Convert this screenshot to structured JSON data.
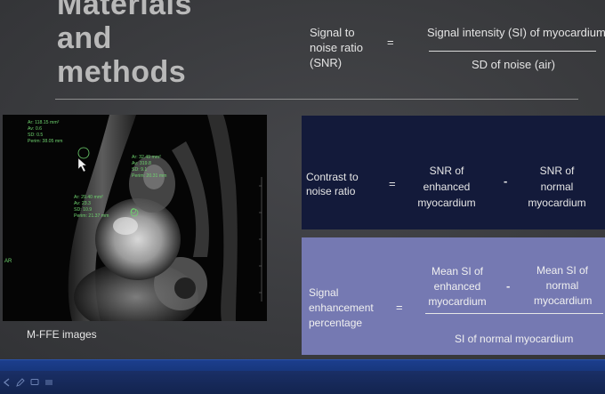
{
  "slide": {
    "title_lines": [
      "Materials",
      "and",
      "methods"
    ],
    "snr": {
      "label_lines": [
        "Signal to",
        "noise ratio",
        "(SNR)"
      ],
      "equals": "=",
      "numerator": "Signal intensity (SI)  of myocardium",
      "denominator": "SD of noise (air)"
    },
    "mri": {
      "caption": "M-FFE images",
      "overlay_texts": [
        "Ar: 118.15 mm²",
        "Av: 0.6",
        "SD: 0.5",
        "Perim: 38.05 mm",
        "Ar: 32.49 mm²",
        "Av: 319.8",
        "SD: 9.1",
        "Perim: 20.31 mm",
        "Ar: 29.40 mm²",
        "Av: 23.3",
        "SD: 10.9",
        "Perim: 21.37 mm",
        "AR"
      ]
    },
    "cnr": {
      "label_lines": [
        "Contrast to",
        "noise ratio"
      ],
      "equals": "=",
      "term_a_lines": [
        "SNR of",
        "enhanced",
        "myocardium"
      ],
      "minus": "-",
      "term_b_lines": [
        "SNR of",
        "normal",
        "myocardium"
      ]
    },
    "sep": {
      "label_lines": [
        "Signal",
        "enhancement",
        "percentage"
      ],
      "equals": "=",
      "term_a_lines": [
        "Mean SI of",
        "enhanced",
        "myocardium"
      ],
      "minus": "-",
      "term_b_lines": [
        "Mean SI of",
        "normal",
        "myocardium"
      ],
      "denominator": "SI of normal myocardium"
    }
  },
  "colors": {
    "background": "#3a3b3e",
    "title": "#b9b9b9",
    "cnr_box": "#131a3a",
    "sep_box": "#7579b2",
    "taskbar": "#163579",
    "overlay_green": "#6fd36f"
  },
  "taskbar_icons": [
    "back-icon",
    "edit-icon",
    "comment-icon",
    "menu-icon"
  ]
}
